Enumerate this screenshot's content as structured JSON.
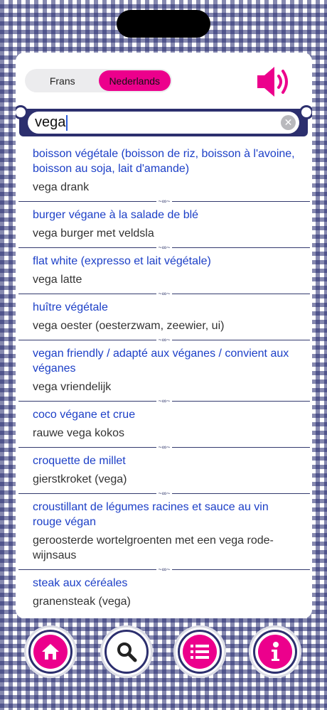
{
  "language_toggle": {
    "option_left": "Frans",
    "option_right": "Nederlands",
    "selected": "Nederlands"
  },
  "search": {
    "value": "vega"
  },
  "entries": [
    {
      "fr": "boisson végétale (boisson de riz, boisson à l'avoine, boisson au soja, lait d'amande)",
      "nl": "vega drank"
    },
    {
      "fr": "burger végane à la salade de blé",
      "nl": "vega burger met veldsla"
    },
    {
      "fr": "flat white (expresso et lait végétale)",
      "nl": "vega latte"
    },
    {
      "fr": "huître végétale",
      "nl": "vega oester (oesterzwam, zeewier, ui)"
    },
    {
      "fr": "vegan friendly / adapté aux véganes / convient aux véganes",
      "nl": "vega vriendelijk"
    },
    {
      "fr": "coco végane et crue",
      "nl": "rauwe vega kokos"
    },
    {
      "fr": "croquette de millet",
      "nl": "gierstkroket (vega)"
    },
    {
      "fr": "croustillant de légumes racines et sauce au vin rouge végan",
      "nl": "geroosterde wortelgroenten met een vega rode-wijnsaus"
    },
    {
      "fr": "steak aux céréales",
      "nl": "granensteak (vega)"
    }
  ],
  "colors": {
    "accent": "#ec008c",
    "navy": "#2c2f6e",
    "link": "#1c3fc7"
  },
  "icons": {
    "speaker": "speaker-icon",
    "home": "home-icon",
    "search": "magnifier-icon",
    "list": "list-icon",
    "info": "info-icon"
  }
}
